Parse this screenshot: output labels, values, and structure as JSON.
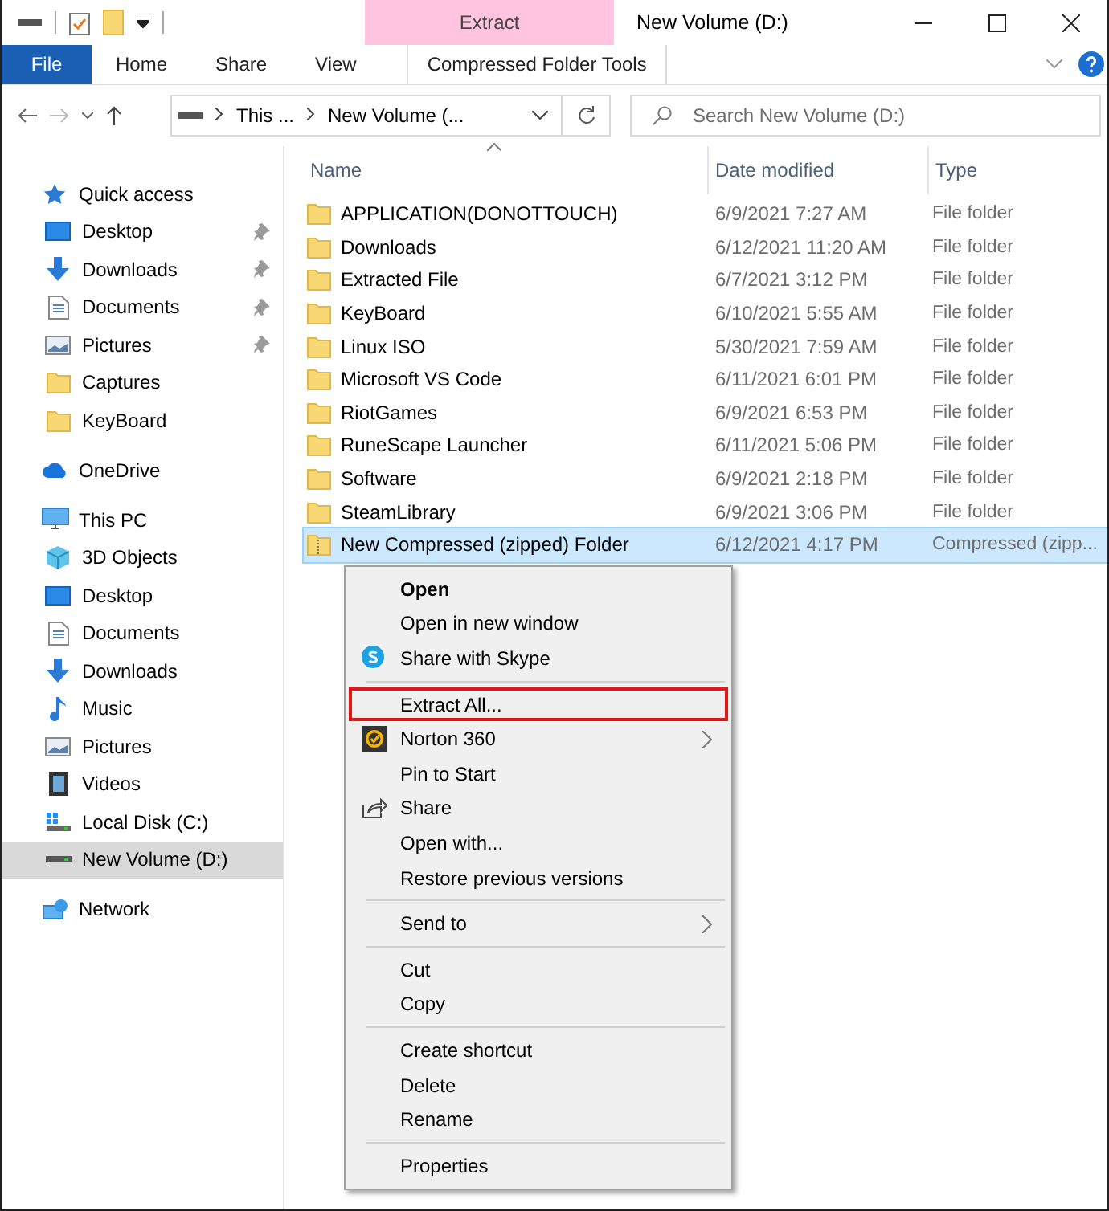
{
  "titlebar": {
    "context_tab": "Extract",
    "title": "New Volume (D:)"
  },
  "ribbon": {
    "tabs": [
      {
        "label": "File",
        "kind": "file",
        "selected": false
      },
      {
        "label": "Home",
        "kind": "plain",
        "selected": false
      },
      {
        "label": "Share",
        "kind": "plain",
        "selected": false
      },
      {
        "label": "View",
        "kind": "plain",
        "selected": false
      },
      {
        "label": "Compressed Folder Tools",
        "kind": "context",
        "selected": false
      }
    ]
  },
  "address": {
    "crumbs": [
      "This ...",
      "New Volume (..."
    ],
    "search": {
      "placeholder": "Search New Volume (D:)"
    }
  },
  "sidebar": {
    "items": [
      {
        "label": "Quick access",
        "kind": "star",
        "selected": false,
        "children": [
          {
            "label": "Desktop",
            "kind": "desktop",
            "pinned": true,
            "selected": false
          },
          {
            "label": "Downloads",
            "kind": "download",
            "pinned": true,
            "selected": false
          },
          {
            "label": "Documents",
            "kind": "document",
            "pinned": true,
            "selected": false
          },
          {
            "label": "Pictures",
            "kind": "pictures",
            "pinned": true,
            "selected": false
          },
          {
            "label": "Captures",
            "kind": "folder",
            "pinned": false,
            "selected": false
          },
          {
            "label": "KeyBoard",
            "kind": "folder",
            "pinned": false,
            "selected": false
          }
        ]
      },
      {
        "label": "OneDrive",
        "kind": "cloud",
        "selected": false
      },
      {
        "label": "This PC",
        "kind": "pc",
        "selected": false,
        "children": [
          {
            "label": "3D Objects",
            "kind": "cube",
            "selected": false
          },
          {
            "label": "Desktop",
            "kind": "desktop",
            "selected": false
          },
          {
            "label": "Documents",
            "kind": "document",
            "selected": false
          },
          {
            "label": "Downloads",
            "kind": "download",
            "selected": false
          },
          {
            "label": "Music",
            "kind": "music",
            "selected": false
          },
          {
            "label": "Pictures",
            "kind": "pictures",
            "selected": false
          },
          {
            "label": "Videos",
            "kind": "video",
            "selected": false
          },
          {
            "label": "Local Disk (C:)",
            "kind": "sysdrive",
            "selected": false
          },
          {
            "label": "New Volume (D:)",
            "kind": "drive",
            "selected": true
          }
        ]
      },
      {
        "label": "Network",
        "kind": "network",
        "selected": false
      }
    ]
  },
  "table": {
    "columns": [
      "Name",
      "Date modified",
      "Type"
    ],
    "rows": [
      {
        "name": "APPLICATION(DONOTTOUCH)",
        "date": "6/9/2021 7:27 AM",
        "type": "File folder",
        "kind": "folder",
        "selected": false
      },
      {
        "name": "Downloads",
        "date": "6/12/2021 11:20 AM",
        "type": "File folder",
        "kind": "folder",
        "selected": false
      },
      {
        "name": "Extracted File",
        "date": "6/7/2021 3:12 PM",
        "type": "File folder",
        "kind": "folder",
        "selected": false
      },
      {
        "name": "KeyBoard",
        "date": "6/10/2021 5:55 AM",
        "type": "File folder",
        "kind": "folder",
        "selected": false
      },
      {
        "name": "Linux ISO",
        "date": "5/30/2021 7:59 AM",
        "type": "File folder",
        "kind": "folder",
        "selected": false
      },
      {
        "name": "Microsoft VS Code",
        "date": "6/11/2021 6:01 PM",
        "type": "File folder",
        "kind": "folder",
        "selected": false
      },
      {
        "name": "RiotGames",
        "date": "6/9/2021 6:53 PM",
        "type": "File folder",
        "kind": "folder",
        "selected": false
      },
      {
        "name": "RuneScape Launcher",
        "date": "6/11/2021 5:06 PM",
        "type": "File folder",
        "kind": "folder",
        "selected": false
      },
      {
        "name": "Software",
        "date": "6/9/2021 2:18 PM",
        "type": "File folder",
        "kind": "folder",
        "selected": false
      },
      {
        "name": "SteamLibrary",
        "date": "6/9/2021 3:06 PM",
        "type": "File folder",
        "kind": "folder",
        "selected": false
      },
      {
        "name": "New Compressed (zipped) Folder",
        "date": "6/12/2021 4:17 PM",
        "type": "Compressed (zipp...",
        "kind": "zip",
        "selected": true
      }
    ]
  },
  "context_menu": {
    "items": [
      {
        "kind": "item",
        "label": "Open",
        "bold": true
      },
      {
        "kind": "item",
        "label": "Open in new window"
      },
      {
        "kind": "skype",
        "label": "Share with Skype"
      },
      {
        "kind": "separator"
      },
      {
        "kind": "item",
        "label": "Extract All...",
        "highlighted": true
      },
      {
        "kind": "norton",
        "label": "Norton 360",
        "submenu": true
      },
      {
        "kind": "item",
        "label": "Pin to Start"
      },
      {
        "kind": "share",
        "label": "Share"
      },
      {
        "kind": "item",
        "label": "Open with..."
      },
      {
        "kind": "item",
        "label": "Restore previous versions"
      },
      {
        "kind": "separator"
      },
      {
        "kind": "item",
        "label": "Send to",
        "submenu": true
      },
      {
        "kind": "separator"
      },
      {
        "kind": "item",
        "label": "Cut"
      },
      {
        "kind": "item",
        "label": "Copy"
      },
      {
        "kind": "separator"
      },
      {
        "kind": "item",
        "label": "Create shortcut"
      },
      {
        "kind": "item",
        "label": "Delete"
      },
      {
        "kind": "item",
        "label": "Rename"
      },
      {
        "kind": "separator"
      },
      {
        "kind": "item",
        "label": "Properties"
      }
    ]
  }
}
